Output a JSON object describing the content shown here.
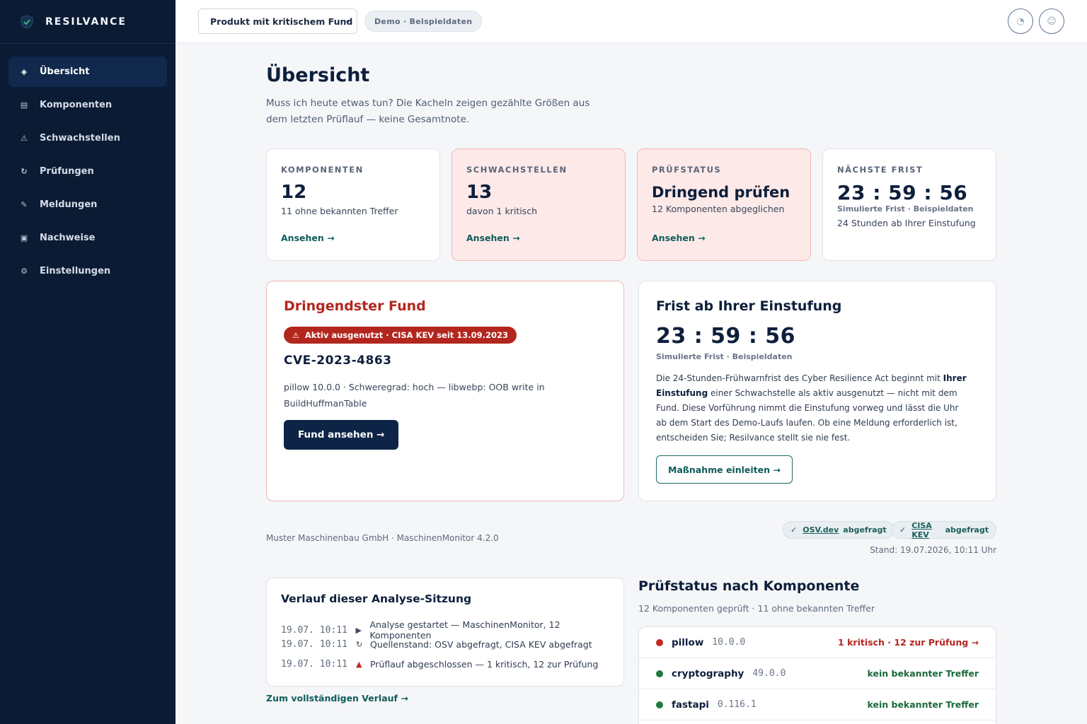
{
  "brand": {
    "name": "RESILVANCE"
  },
  "sidebar": {
    "items": [
      {
        "label": "Übersicht",
        "icon": "◈",
        "active": true
      },
      {
        "label": "Komponenten",
        "icon": "▤"
      },
      {
        "label": "Schwachstellen",
        "icon": "⚠"
      },
      {
        "label": "Prüfungen",
        "icon": "↻"
      },
      {
        "label": "Meldungen",
        "icon": "✎"
      },
      {
        "label": "Nachweise",
        "icon": "▣"
      },
      {
        "label": "Einstellungen",
        "icon": "⚙"
      }
    ]
  },
  "topbar": {
    "product_select": "Produkt mit kritischem Fund",
    "demo_badge": "Demo · Beispieldaten",
    "theme_icon": "◔",
    "user_icon": "☺"
  },
  "page": {
    "title": "Übersicht",
    "subtitle": "Muss ich heute etwas tun? Die Kacheln zeigen gezählte Größen aus dem letzten Prüflauf — keine Gesamtnote."
  },
  "tiles": [
    {
      "label": "KOMPONENTEN",
      "value": "12",
      "desc": "11 ohne bekannten Treffer",
      "link": "Ansehen →"
    },
    {
      "label": "SCHWACHSTELLEN",
      "value": "13",
      "desc": "davon 1 kritisch",
      "link": "Ansehen →"
    },
    {
      "label": "PRÜFSTATUS",
      "value": "Dringend prüfen",
      "desc": "12 Komponenten abgeglichen",
      "link": "Ansehen →"
    },
    {
      "label": "NÄCHSTE FRIST",
      "value": "23 : 59 : 56",
      "sim": "Simulierte Frist · Beispieldaten",
      "desc": "24 Stunden ab Ihrer Einstufung"
    }
  ],
  "urgent": {
    "title": "Dringendster Fund",
    "badge": "Aktiv ausgenutzt · CISA KEV seit 13.09.2023",
    "cve": "CVE-2023-4863",
    "desc": "pillow 10.0.0 · Schweregrad: hoch — libwebp: OOB write in BuildHuffmanTable",
    "button": "Fund ansehen →"
  },
  "deadline": {
    "title": "Frist ab Ihrer Einstufung",
    "timer": "23 : 59 : 56",
    "sim": "Simulierte Frist · Beispieldaten",
    "text_1": "Die 24-Stunden-Frühwarnfrist des Cyber Resilience Act beginnt mit ",
    "text_bold": "Ihrer Einstufung",
    "text_2": " einer Schwachstelle als aktiv ausgenutzt — nicht mit dem Fund. Diese Vorführung nimmt die Einstufung vorweg und lässt die Uhr ab dem Start des Demo-Laufs laufen. Ob eine Meldung erforderlich ist, entscheiden Sie; Resilvance stellt sie nie fest.",
    "button": "Maßnahme einleiten →"
  },
  "meta": {
    "company": "Muster Maschinenbau GmbH · MaschinenMonitor 4.2.0",
    "sources": [
      {
        "name": "OSV.dev",
        "suffix": "abgefragt"
      },
      {
        "name": "CISA KEV",
        "suffix": "abgefragt"
      }
    ],
    "stand": "Stand: 19.07.2026, 10:11 Uhr"
  },
  "verlauf": {
    "title": "Verlauf dieser Analyse-Sitzung",
    "rows": [
      {
        "time": "19.07. 10:11",
        "icon": "▶",
        "text": "Analyse gestartet — MaschinenMonitor, 12 Komponenten"
      },
      {
        "time": "19.07. 10:11",
        "icon": "↻",
        "text": "Quellenstand: OSV abgefragt, CISA KEV abgefragt"
      },
      {
        "time": "19.07. 10:11",
        "icon": "▲",
        "text": "Prüflauf abgeschlossen — 1 kritisch, 12 zur Prüfung"
      }
    ],
    "link": "Zum vollständigen Verlauf →"
  },
  "komponenten": {
    "title": "Prüfstatus nach Komponente",
    "sub": "12 Komponenten geprüft · 11 ohne bekannten Treffer",
    "rows": [
      {
        "name": "pillow",
        "version": "10.0.0",
        "status": "1 kritisch · 12 zur Prüfung →",
        "color": "#c0281f"
      },
      {
        "name": "cryptography",
        "version": "49.0.0",
        "status": "kein bekannter Treffer",
        "color": "#1f7a3e"
      },
      {
        "name": "fastapi",
        "version": "0.116.1",
        "status": "kein bekannter Treffer",
        "color": "#1f7a3e"
      }
    ]
  },
  "colors": {
    "critical": "#c0281f",
    "ok": "#1f7a3e",
    "accent": "#0f5c5a",
    "sidebar": "#0b1b33"
  }
}
